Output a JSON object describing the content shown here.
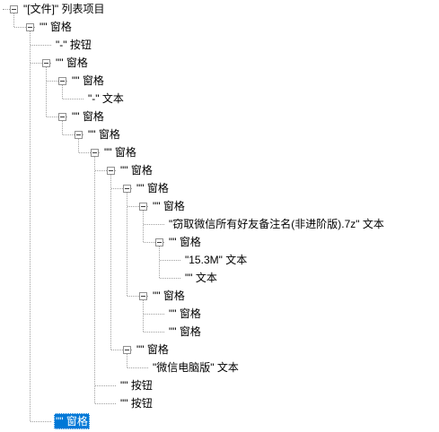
{
  "tree": {
    "nodes": [
      {
        "id": "n0",
        "label": "\"[文件]\" 列表项目",
        "level": 0,
        "expanded": true,
        "selected": false
      },
      {
        "id": "n1",
        "label": "\"\" 窗格",
        "level": 1,
        "expanded": true,
        "selected": false
      },
      {
        "id": "n2",
        "label": "\"-\" 按钮",
        "level": 2,
        "expanded": null,
        "selected": false
      },
      {
        "id": "n3",
        "label": "\"\" 窗格",
        "level": 2,
        "expanded": true,
        "selected": false
      },
      {
        "id": "n4",
        "label": "\"\" 窗格",
        "level": 3,
        "expanded": true,
        "selected": false
      },
      {
        "id": "n5",
        "label": "\"-\" 文本",
        "level": 4,
        "expanded": null,
        "selected": false
      },
      {
        "id": "n6",
        "label": "\"\" 窗格",
        "level": 3,
        "expanded": true,
        "selected": false
      },
      {
        "id": "n7",
        "label": "\"\" 窗格",
        "level": 4,
        "expanded": true,
        "selected": false
      },
      {
        "id": "n8",
        "label": "\"\" 窗格",
        "level": 5,
        "expanded": true,
        "selected": false
      },
      {
        "id": "n9",
        "label": "\"\" 窗格",
        "level": 6,
        "expanded": true,
        "selected": false
      },
      {
        "id": "n10",
        "label": "\"\" 窗格",
        "level": 7,
        "expanded": true,
        "selected": false
      },
      {
        "id": "n11",
        "label": "\"\" 窗格",
        "level": 8,
        "expanded": true,
        "selected": false
      },
      {
        "id": "n12",
        "label": "\"窃取微信所有好友备注名(非进阶版).7z\" 文本",
        "level": 9,
        "expanded": null,
        "selected": false
      },
      {
        "id": "n13",
        "label": "\"\" 窗格",
        "level": 9,
        "expanded": true,
        "selected": false
      },
      {
        "id": "n14",
        "label": "\"15.3M\" 文本",
        "level": 10,
        "expanded": null,
        "selected": false
      },
      {
        "id": "n15",
        "label": "\"\" 文本",
        "level": 10,
        "expanded": null,
        "selected": false
      },
      {
        "id": "n16",
        "label": "\"\" 窗格",
        "level": 8,
        "expanded": true,
        "selected": false
      },
      {
        "id": "n17",
        "label": "\"\" 窗格",
        "level": 9,
        "expanded": null,
        "selected": false
      },
      {
        "id": "n18",
        "label": "\"\" 窗格",
        "level": 9,
        "expanded": null,
        "selected": false
      },
      {
        "id": "n19",
        "label": "\"\" 窗格",
        "level": 7,
        "expanded": true,
        "selected": false
      },
      {
        "id": "n20",
        "label": "\"微信电脑版\" 文本",
        "level": 8,
        "expanded": null,
        "selected": false
      },
      {
        "id": "n21",
        "label": "\"\" 按钮",
        "level": 6,
        "expanded": null,
        "selected": false
      },
      {
        "id": "n22",
        "label": "\"\" 按钮",
        "level": 6,
        "expanded": null,
        "selected": false
      },
      {
        "id": "n23",
        "label": "\"\" 窗格",
        "level": 2,
        "expanded": null,
        "selected": true
      }
    ]
  },
  "colors": {
    "selection_bg": "#0078d7",
    "selection_text": "#ffffff",
    "connector": "#a0a0a0",
    "expander_border": "#919191"
  }
}
